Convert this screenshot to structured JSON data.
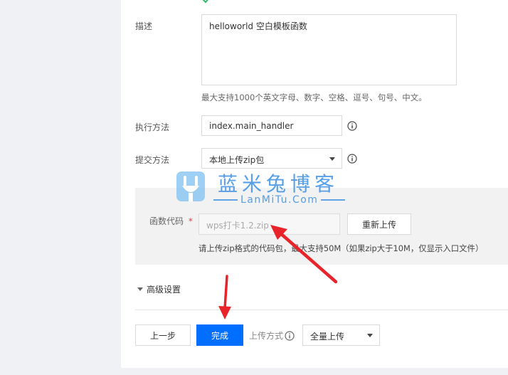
{
  "form": {
    "desc_label": "描述",
    "desc_value": "helloworld 空白模板函数",
    "desc_hint": "最大支持1000个英文字母、数字、空格、逗号、句号、中文。",
    "exec_label": "执行方法",
    "exec_value": "index.main_handler",
    "submit_label": "提交方法",
    "submit_value": "本地上传zip包",
    "code_label": "函数代码",
    "code_required": "*",
    "code_file": "wps打卡1.2.zip",
    "reupload_label": "重新上传",
    "code_hint": "请上传zip格式的代码包，最大支持50M（如果zip大于10M，仅显示入口文件）",
    "advanced_label": "高级设置"
  },
  "footer": {
    "prev_label": "上一步",
    "done_label": "完成",
    "upload_mode_label": "上传方式",
    "upload_mode_value": "全量上传"
  },
  "watermark": {
    "title": "蓝米兔博客",
    "domain": "LanMiTu.Com"
  },
  "colors": {
    "primary": "#006eff",
    "arrow": "#e8232a",
    "watermark": "#3b8fe3"
  }
}
